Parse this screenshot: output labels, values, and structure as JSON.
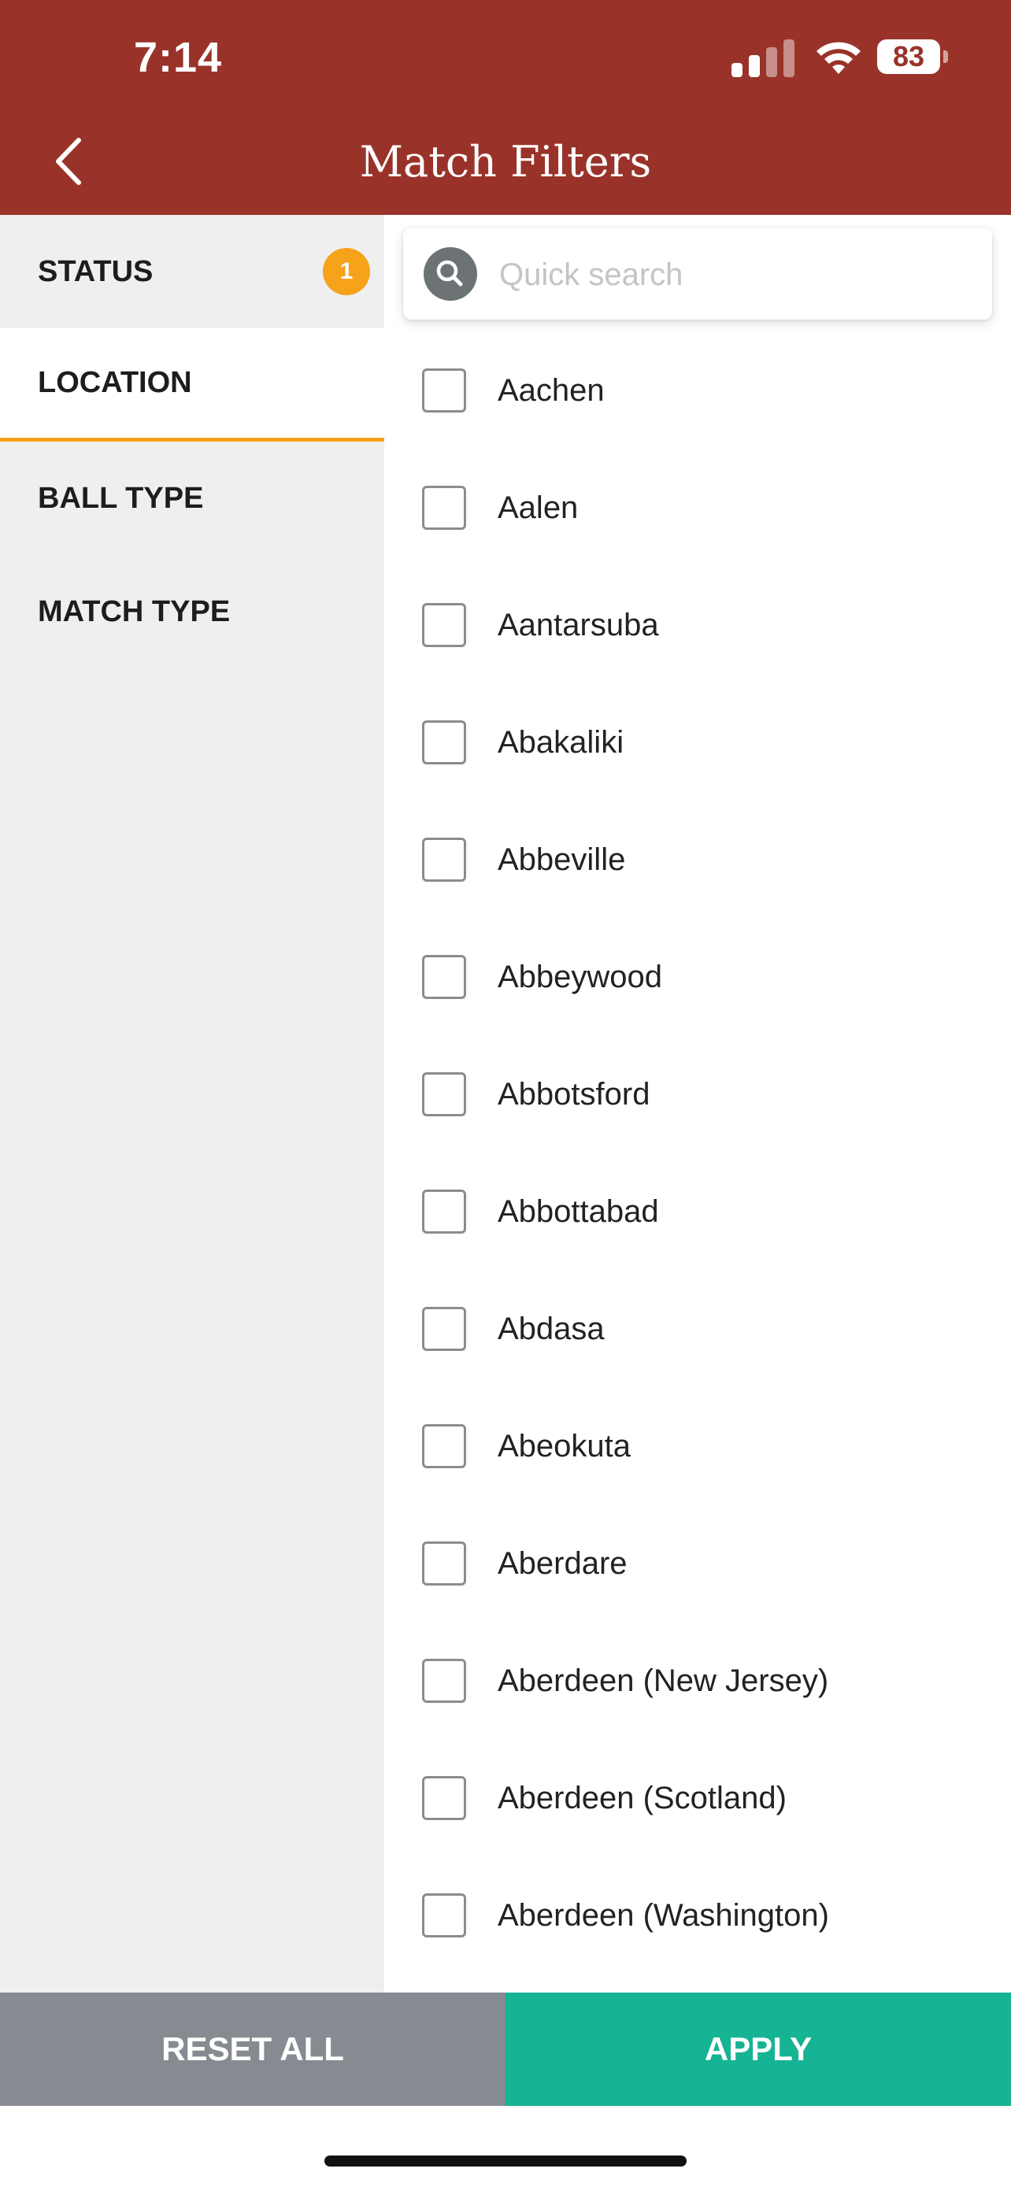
{
  "status_bar": {
    "time": "7:14",
    "battery": "83",
    "icons": [
      "cellular-signal-icon",
      "wifi-icon",
      "battery-icon"
    ]
  },
  "header": {
    "title": "Match Filters",
    "back_icon": "chevron-left-icon",
    "background": "#993329"
  },
  "sidebar": {
    "items": [
      {
        "label": "STATUS",
        "badge": "1"
      },
      {
        "label": "LOCATION",
        "active": true
      },
      {
        "label": "BALL TYPE"
      },
      {
        "label": "MATCH TYPE"
      }
    ]
  },
  "search": {
    "placeholder": "Quick search",
    "value": "",
    "icon": "search-icon"
  },
  "locations": [
    {
      "label": "Aachen",
      "checked": false
    },
    {
      "label": "Aalen",
      "checked": false
    },
    {
      "label": "Aantarsuba",
      "checked": false
    },
    {
      "label": "Abakaliki",
      "checked": false
    },
    {
      "label": "Abbeville",
      "checked": false
    },
    {
      "label": "Abbeywood",
      "checked": false
    },
    {
      "label": "Abbotsford",
      "checked": false
    },
    {
      "label": "Abbottabad",
      "checked": false
    },
    {
      "label": "Abdasa",
      "checked": false
    },
    {
      "label": "Abeokuta",
      "checked": false
    },
    {
      "label": "Aberdare",
      "checked": false
    },
    {
      "label": "Aberdeen (New Jersey)",
      "checked": false
    },
    {
      "label": "Aberdeen (Scotland)",
      "checked": false
    },
    {
      "label": "Aberdeen (Washington)",
      "checked": false
    }
  ],
  "footer": {
    "reset_label": "RESET ALL",
    "apply_label": "APPLY",
    "reset_color": "#868b91",
    "apply_color": "#16b394"
  },
  "colors": {
    "accent": "#f5a21a",
    "badge": "#f7a21b"
  }
}
